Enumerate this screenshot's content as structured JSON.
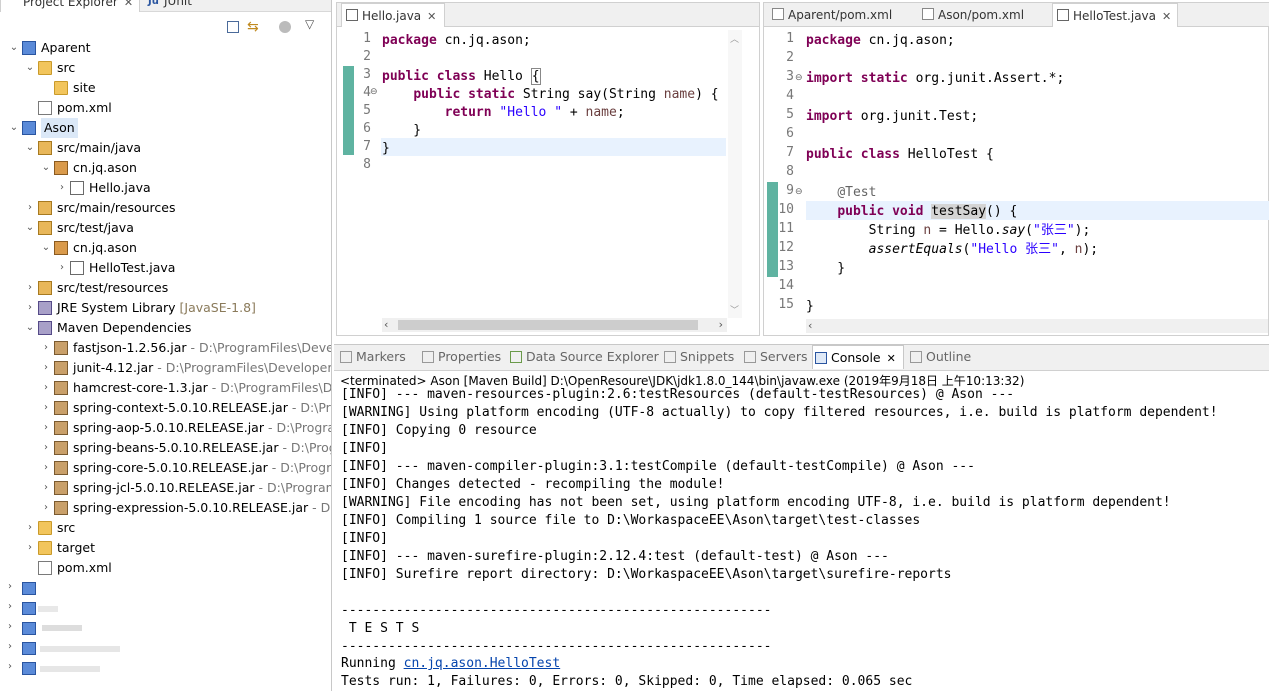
{
  "explorer": {
    "tabs": [
      {
        "label": "Project Explorer",
        "close": "✕"
      },
      {
        "label": "JUnit"
      }
    ],
    "tree": [
      {
        "label": "Aparent",
        "twisty": "⌄",
        "icon": "project-icon"
      },
      {
        "label": "src",
        "twisty": "⌄",
        "icon": "folder-icon"
      },
      {
        "label": "site",
        "twisty": "",
        "icon": "folder-icon"
      },
      {
        "label": "pom.xml",
        "twisty": "",
        "icon": "xml-file-icon"
      },
      {
        "label": "Ason",
        "twisty": "⌄",
        "icon": "project-icon"
      },
      {
        "label": "src/main/java",
        "twisty": "⌄",
        "icon": "source-folder-icon"
      },
      {
        "label": "cn.jq.ason",
        "twisty": "⌄",
        "icon": "package-icon"
      },
      {
        "label": "Hello.java",
        "twisty": "›",
        "icon": "java-file-icon"
      },
      {
        "label": "src/main/resources",
        "twisty": "›",
        "icon": "source-folder-icon"
      },
      {
        "label": "src/test/java",
        "twisty": "⌄",
        "icon": "source-folder-icon"
      },
      {
        "label": "cn.jq.ason",
        "twisty": "⌄",
        "icon": "package-icon"
      },
      {
        "label": "HelloTest.java",
        "twisty": "›",
        "icon": "java-file-icon"
      },
      {
        "label": "src/test/resources",
        "twisty": "›",
        "icon": "source-folder-icon"
      },
      {
        "label": "JRE System Library",
        "decoration": "[JavaSE-1.8]",
        "twisty": "›",
        "icon": "library-icon"
      },
      {
        "label": "Maven Dependencies",
        "twisty": "⌄",
        "icon": "library-icon"
      },
      {
        "label": "fastjson-1.2.56.jar",
        "path": " - D:\\ProgramFiles\\Develop",
        "twisty": "›",
        "icon": "jar-icon"
      },
      {
        "label": "junit-4.12.jar",
        "path": " - D:\\ProgramFiles\\DeveloperTo",
        "twisty": "›",
        "icon": "jar-icon"
      },
      {
        "label": "hamcrest-core-1.3.jar",
        "path": " - D:\\ProgramFiles\\Dev",
        "twisty": "›",
        "icon": "jar-icon"
      },
      {
        "label": "spring-context-5.0.10.RELEASE.jar",
        "path": " - D:\\Progr",
        "twisty": "›",
        "icon": "jar-icon"
      },
      {
        "label": "spring-aop-5.0.10.RELEASE.jar",
        "path": " - D:\\Program",
        "twisty": "›",
        "icon": "jar-icon"
      },
      {
        "label": "spring-beans-5.0.10.RELEASE.jar",
        "path": " - D:\\Progra",
        "twisty": "›",
        "icon": "jar-icon"
      },
      {
        "label": "spring-core-5.0.10.RELEASE.jar",
        "path": " - D:\\Program",
        "twisty": "›",
        "icon": "jar-icon"
      },
      {
        "label": "spring-jcl-5.0.10.RELEASE.jar",
        "path": " - D:\\ProgramFil",
        "twisty": "›",
        "icon": "jar-icon"
      },
      {
        "label": "spring-expression-5.0.10.RELEASE.jar",
        "path": " - D:\\Pr",
        "twisty": "›",
        "icon": "jar-icon"
      },
      {
        "label": "src",
        "twisty": "›",
        "icon": "folder-icon"
      },
      {
        "label": "target",
        "twisty": "›",
        "icon": "folder-icon"
      },
      {
        "label": "pom.xml",
        "twisty": "",
        "icon": "xml-file-icon"
      }
    ]
  },
  "editor_left": {
    "tab": {
      "label": "Hello.java",
      "close": "✕"
    },
    "lines": [
      "1",
      "2",
      "3",
      "4",
      "5",
      "6",
      "7",
      "8"
    ]
  },
  "editor_right": {
    "tabs": [
      {
        "label": "Aparent/pom.xml"
      },
      {
        "label": "Ason/pom.xml"
      },
      {
        "label": "HelloTest.java",
        "close": "✕"
      }
    ],
    "lines": [
      "1",
      "2",
      "3",
      "4",
      "5",
      "6",
      "7",
      "8",
      "9",
      "10",
      "11",
      "12",
      "13",
      "14",
      "15"
    ]
  },
  "views": {
    "tabs": [
      {
        "label": "Markers"
      },
      {
        "label": "Properties"
      },
      {
        "label": "Data Source Explorer"
      },
      {
        "label": "Snippets"
      },
      {
        "label": "Servers"
      },
      {
        "label": "Console",
        "close": "✕"
      },
      {
        "label": "Outline"
      }
    ]
  },
  "console": {
    "status": "<terminated> Ason [Maven Build] D:\\OpenResoure\\JDK\\jdk1.8.0_144\\bin\\javaw.exe (2019年9月18日 上午10:13:32)",
    "lines": [
      "[INFO] --- maven-resources-plugin:2.6:testResources (default-testResources) @ Ason ---",
      "[WARNING] Using platform encoding (UTF-8 actually) to copy filtered resources, i.e. build is platform dependent!",
      "[INFO] Copying 0 resource",
      "[INFO]",
      "[INFO] --- maven-compiler-plugin:3.1:testCompile (default-testCompile) @ Ason ---",
      "[INFO] Changes detected - recompiling the module!",
      "[WARNING] File encoding has not been set, using platform encoding UTF-8, i.e. build is platform dependent!",
      "[INFO] Compiling 1 source file to D:\\WorkaspaceEE\\Ason\\target\\test-classes",
      "[INFO]",
      "[INFO] --- maven-surefire-plugin:2.12.4:test (default-test) @ Ason ---",
      "[INFO] Surefire report directory: D:\\WorkaspaceEE\\Ason\\target\\surefire-reports",
      "",
      "-------------------------------------------------------",
      " T E S T S",
      "-------------------------------------------------------"
    ],
    "running_prefix": "Running ",
    "running_link": "cn.jq.ason.HelloTest",
    "result": "Tests run: 1, Failures: 0, Errors: 0, Skipped: 0, Time elapsed: 0.065 sec"
  }
}
